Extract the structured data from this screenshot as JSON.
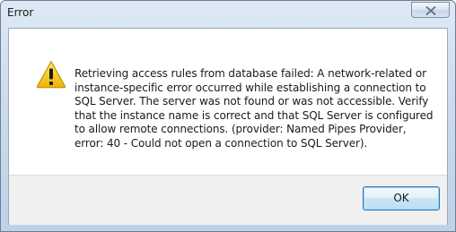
{
  "window": {
    "title": "Error"
  },
  "dialog": {
    "icon": "warning-icon",
    "message": "Retrieving access rules from database failed: A network-related or instance-specific error occurred while establishing a connection to SQL Server. The server was not found or was not accessible. Verify that the instance name is correct and that SQL Server is configured to allow remote connections. (provider: Named Pipes Provider, error: 40 - Could not open a connection to SQL Server).",
    "ok_label": "OK"
  },
  "colors": {
    "title_bar": "#cddcee",
    "warning_yellow": "#f5c400",
    "button_border": "#2f78b5"
  }
}
